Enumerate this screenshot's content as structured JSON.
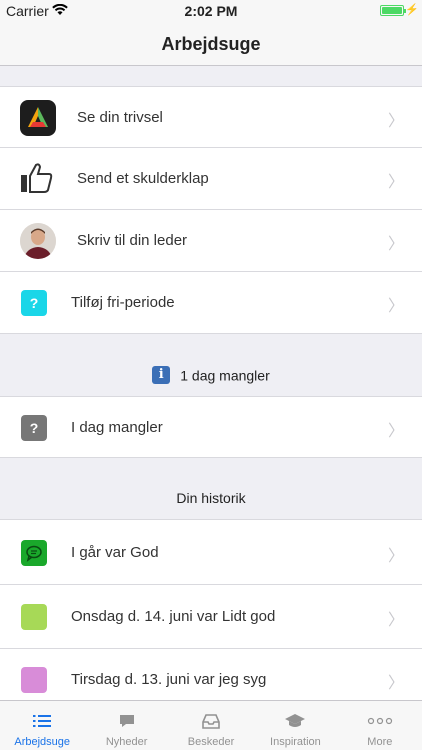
{
  "status_bar": {
    "carrier": "Carrier",
    "time": "2:02 PM",
    "battery_level": 1.0
  },
  "nav": {
    "title": "Arbejdsuge"
  },
  "actions": [
    {
      "label": "Se din trivsel",
      "icon": "trivsel-app-icon"
    },
    {
      "label": "Send et skulderklap",
      "icon": "thumbs-up-icon"
    },
    {
      "label": "Skriv til din leder",
      "icon": "avatar"
    },
    {
      "label": "Tilføj fri-periode",
      "icon": "question-icon",
      "color": "#1ad6e8"
    }
  ],
  "missing": {
    "header": "1 dag mangler",
    "item_label": "I dag mangler",
    "item_color": "#777777"
  },
  "history": {
    "header": "Din historik",
    "items": [
      {
        "label": "I går var God",
        "color": "#1aa82b"
      },
      {
        "label": "Onsdag d. 14. juni var Lidt god",
        "color": "#a7d957"
      },
      {
        "label": "Tirsdag d. 13. juni var jeg syg",
        "color": "#d88cd8"
      }
    ]
  },
  "tabs": [
    {
      "label": "Arbejdsuge",
      "icon": "list-icon",
      "active": true
    },
    {
      "label": "Nyheder",
      "icon": "chat-bubble-icon",
      "active": false
    },
    {
      "label": "Beskeder",
      "icon": "inbox-icon",
      "active": false
    },
    {
      "label": "Inspiration",
      "icon": "graduation-cap-icon",
      "active": false
    },
    {
      "label": "More",
      "icon": "more-icon",
      "active": false
    }
  ]
}
